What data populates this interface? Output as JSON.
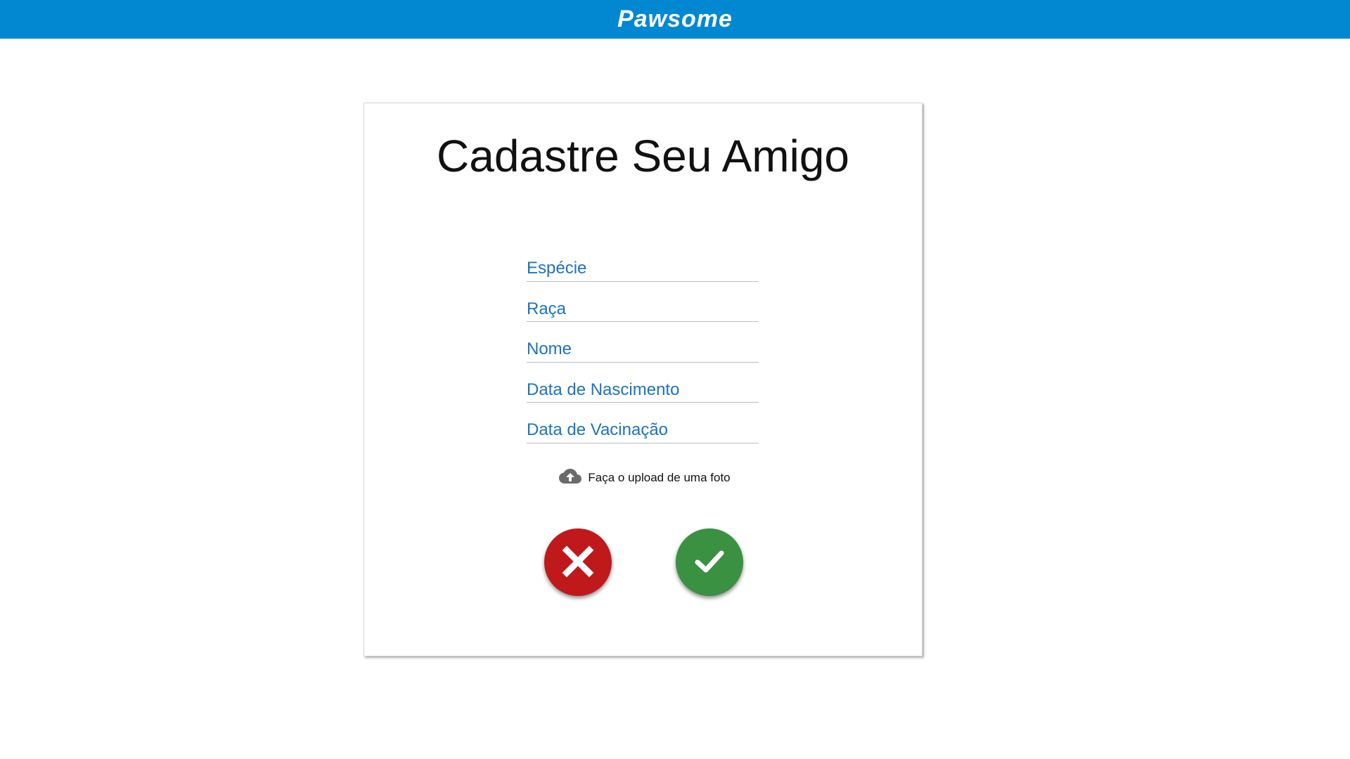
{
  "app": {
    "brand": "Pawsome"
  },
  "form": {
    "title": "Cadastre Seu Amigo",
    "fields": [
      {
        "placeholder": "Espécie",
        "value": ""
      },
      {
        "placeholder": "Raça",
        "value": ""
      },
      {
        "placeholder": "Nome",
        "value": ""
      },
      {
        "placeholder": "Data de Nascimento",
        "value": ""
      },
      {
        "placeholder": "Data de Vacinação",
        "value": ""
      }
    ],
    "upload_label": "Faça o upload de uma foto",
    "upload_icon": "cloud-upload-icon",
    "cancel_icon": "close-icon",
    "confirm_icon": "check-icon"
  },
  "colors": {
    "topbar": "#0288d1",
    "field_text": "#1e73be",
    "cancel": "#c0191c",
    "confirm": "#3a9141"
  }
}
